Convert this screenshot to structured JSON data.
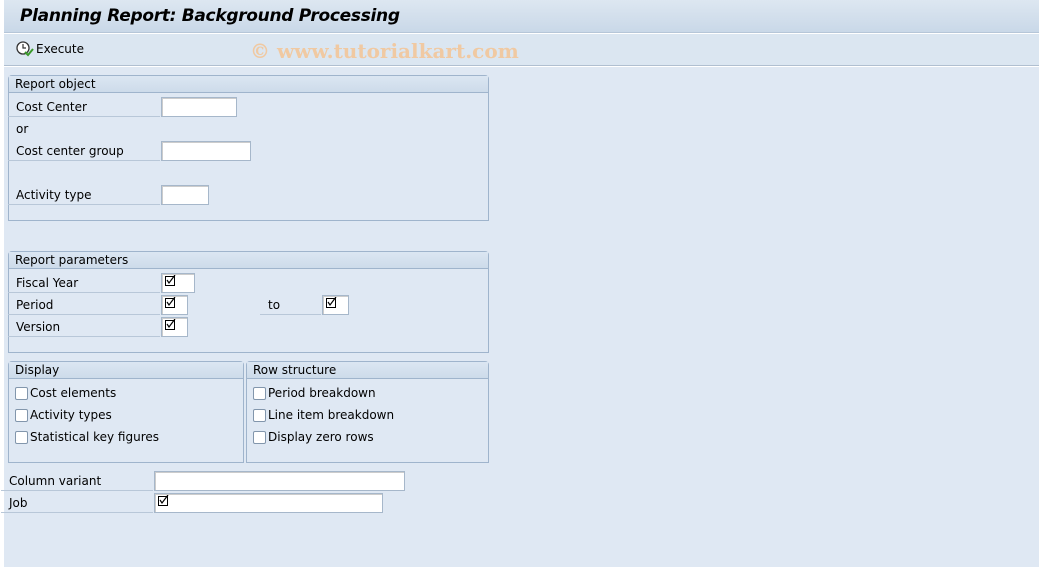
{
  "title": "Planning Report: Background Processing",
  "toolbar": {
    "execute_label": "Execute",
    "execute_icon": "execute-clock-icon"
  },
  "watermark": "© www.tutorialkart.com",
  "report_object": {
    "title": "Report object",
    "cost_center": "Cost Center",
    "or": "or",
    "cost_center_group": "Cost center group",
    "activity_type": "Activity type",
    "cost_center_value": "",
    "cost_center_group_value": "",
    "activity_type_value": ""
  },
  "report_parameters": {
    "title": "Report parameters",
    "fiscal_year": "Fiscal Year",
    "period": "Period",
    "to": "to",
    "version": "Version",
    "required_icon": "required-check-icon"
  },
  "display": {
    "title": "Display",
    "items": [
      {
        "label": "Cost elements",
        "checked": false
      },
      {
        "label": "Activity types",
        "checked": false
      },
      {
        "label": "Statistical key figures",
        "checked": false
      }
    ]
  },
  "row_structure": {
    "title": "Row structure",
    "items": [
      {
        "label": "Period breakdown",
        "checked": false
      },
      {
        "label": "Line item breakdown",
        "checked": false
      },
      {
        "label": "Display zero rows",
        "checked": false
      }
    ]
  },
  "column_variant": {
    "label": "Column variant",
    "value": ""
  },
  "job": {
    "label": "Job"
  }
}
